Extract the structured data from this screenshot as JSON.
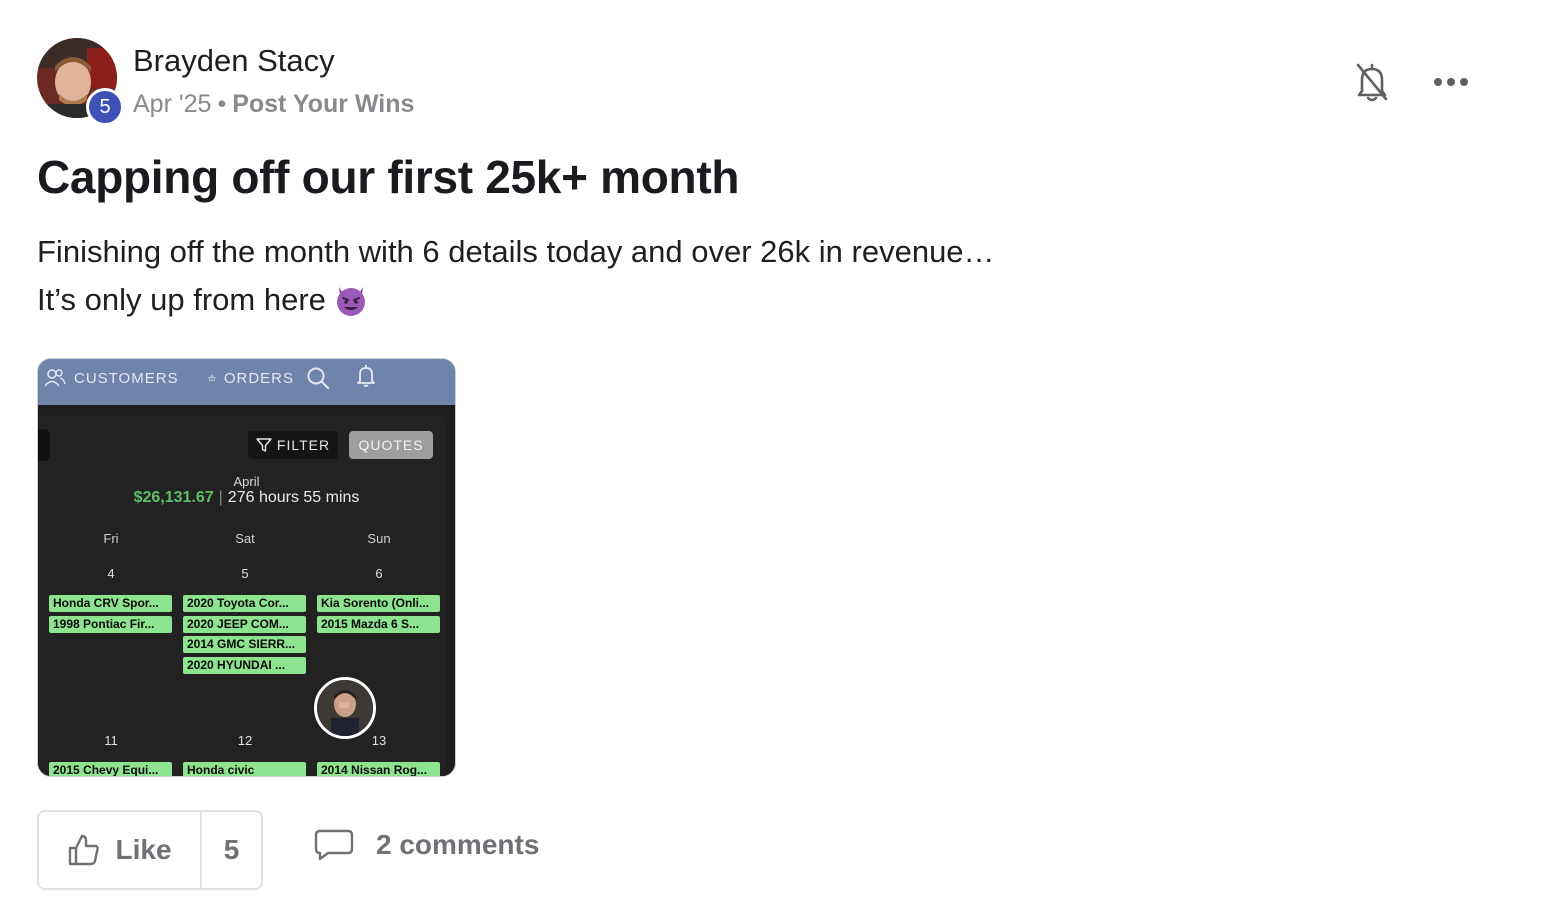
{
  "post": {
    "author": "Brayden Stacy",
    "level": "5",
    "date": "Apr '25",
    "separator": "•",
    "category": "Post Your Wins",
    "title": "Capping off our first 25k+ month",
    "body_line1": "Finishing off the month with 6 details today and over 26k in revenue…",
    "body_line2": "It’s only up from here",
    "body_emoji": "smiling-devil-emoji"
  },
  "header_icons": {
    "bell": "bell-off-icon",
    "more": "more-horizontal-icon"
  },
  "screenshot": {
    "nav": {
      "customers": "CUSTOMERS",
      "orders": "ORDERS"
    },
    "filter_label": "FILTER",
    "quotes_label": "QUOTES",
    "month": "April",
    "revenue": "$26,131.67",
    "divider": "|",
    "hours": "276 hours 55 mins",
    "days": [
      "Fri",
      "Sat",
      "Sun"
    ],
    "week1": {
      "dates": [
        "4",
        "5",
        "6"
      ],
      "col1": [
        "Honda CRV Spor...",
        "1998 Pontiac Fir..."
      ],
      "col2": [
        "2020 Toyota Cor...",
        "2020 JEEP COM...",
        "2014 GMC SIERR...",
        "2020 HYUNDAI ..."
      ],
      "col3": [
        "Kia Sorento (Onli...",
        "2015 Mazda 6 S..."
      ]
    },
    "week2": {
      "dates": [
        "11",
        "12",
        "13"
      ],
      "col1": [
        "2015 Chevy Equi..."
      ],
      "col2": [
        "Honda civic"
      ],
      "col3": [
        "2014 Nissan Rog..."
      ]
    },
    "colors": {
      "nav": "#6f84ab",
      "event": "#8ee38f",
      "revenue": "#5fbf66"
    }
  },
  "actions": {
    "like_label": "Like",
    "like_count": "5",
    "comments_label": "2 comments"
  },
  "colors": {
    "badge": "#3f51b5",
    "muted_text": "#8a8a8e"
  }
}
